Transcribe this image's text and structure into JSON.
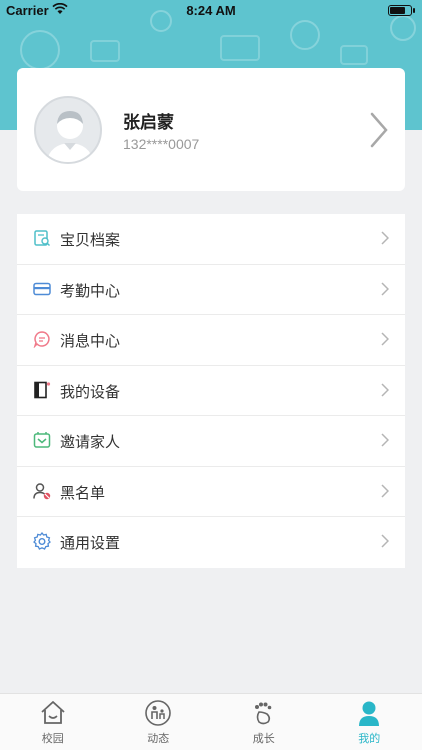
{
  "status_bar": {
    "carrier": "Carrier",
    "time": "8:24 AM"
  },
  "profile": {
    "name": "张启蒙",
    "phone": "132****0007"
  },
  "menu": {
    "items": [
      {
        "label": "宝贝档案",
        "icon": "baby-file-icon"
      },
      {
        "label": "考勤中心",
        "icon": "card-icon"
      },
      {
        "label": "消息中心",
        "icon": "message-icon"
      },
      {
        "label": "我的设备",
        "icon": "device-icon"
      },
      {
        "label": "邀请家人",
        "icon": "invite-icon"
      },
      {
        "label": "黑名单",
        "icon": "blacklist-icon"
      },
      {
        "label": "通用设置",
        "icon": "gear-icon"
      }
    ]
  },
  "tabs": [
    {
      "label": "校园",
      "icon": "house-icon",
      "active": false
    },
    {
      "label": "动态",
      "icon": "family-icon",
      "active": false
    },
    {
      "label": "成长",
      "icon": "footprint-icon",
      "active": false
    },
    {
      "label": "我的",
      "icon": "person-icon",
      "active": true
    }
  ],
  "colors": {
    "accent": "#5ec4cf",
    "tab_active": "#29b6c8"
  }
}
